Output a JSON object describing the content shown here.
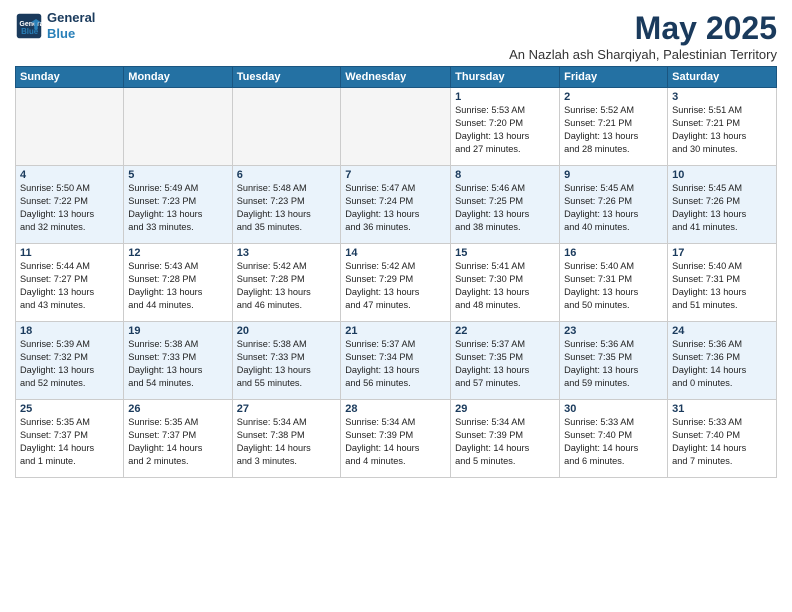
{
  "header": {
    "logo_line1": "General",
    "logo_line2": "Blue",
    "month_title": "May 2025",
    "subtitle": "An Nazlah ash Sharqiyah, Palestinian Territory"
  },
  "weekdays": [
    "Sunday",
    "Monday",
    "Tuesday",
    "Wednesday",
    "Thursday",
    "Friday",
    "Saturday"
  ],
  "weeks": [
    [
      {
        "day": "",
        "detail": ""
      },
      {
        "day": "",
        "detail": ""
      },
      {
        "day": "",
        "detail": ""
      },
      {
        "day": "",
        "detail": ""
      },
      {
        "day": "1",
        "detail": "Sunrise: 5:53 AM\nSunset: 7:20 PM\nDaylight: 13 hours\nand 27 minutes."
      },
      {
        "day": "2",
        "detail": "Sunrise: 5:52 AM\nSunset: 7:21 PM\nDaylight: 13 hours\nand 28 minutes."
      },
      {
        "day": "3",
        "detail": "Sunrise: 5:51 AM\nSunset: 7:21 PM\nDaylight: 13 hours\nand 30 minutes."
      }
    ],
    [
      {
        "day": "4",
        "detail": "Sunrise: 5:50 AM\nSunset: 7:22 PM\nDaylight: 13 hours\nand 32 minutes."
      },
      {
        "day": "5",
        "detail": "Sunrise: 5:49 AM\nSunset: 7:23 PM\nDaylight: 13 hours\nand 33 minutes."
      },
      {
        "day": "6",
        "detail": "Sunrise: 5:48 AM\nSunset: 7:23 PM\nDaylight: 13 hours\nand 35 minutes."
      },
      {
        "day": "7",
        "detail": "Sunrise: 5:47 AM\nSunset: 7:24 PM\nDaylight: 13 hours\nand 36 minutes."
      },
      {
        "day": "8",
        "detail": "Sunrise: 5:46 AM\nSunset: 7:25 PM\nDaylight: 13 hours\nand 38 minutes."
      },
      {
        "day": "9",
        "detail": "Sunrise: 5:45 AM\nSunset: 7:26 PM\nDaylight: 13 hours\nand 40 minutes."
      },
      {
        "day": "10",
        "detail": "Sunrise: 5:45 AM\nSunset: 7:26 PM\nDaylight: 13 hours\nand 41 minutes."
      }
    ],
    [
      {
        "day": "11",
        "detail": "Sunrise: 5:44 AM\nSunset: 7:27 PM\nDaylight: 13 hours\nand 43 minutes."
      },
      {
        "day": "12",
        "detail": "Sunrise: 5:43 AM\nSunset: 7:28 PM\nDaylight: 13 hours\nand 44 minutes."
      },
      {
        "day": "13",
        "detail": "Sunrise: 5:42 AM\nSunset: 7:28 PM\nDaylight: 13 hours\nand 46 minutes."
      },
      {
        "day": "14",
        "detail": "Sunrise: 5:42 AM\nSunset: 7:29 PM\nDaylight: 13 hours\nand 47 minutes."
      },
      {
        "day": "15",
        "detail": "Sunrise: 5:41 AM\nSunset: 7:30 PM\nDaylight: 13 hours\nand 48 minutes."
      },
      {
        "day": "16",
        "detail": "Sunrise: 5:40 AM\nSunset: 7:31 PM\nDaylight: 13 hours\nand 50 minutes."
      },
      {
        "day": "17",
        "detail": "Sunrise: 5:40 AM\nSunset: 7:31 PM\nDaylight: 13 hours\nand 51 minutes."
      }
    ],
    [
      {
        "day": "18",
        "detail": "Sunrise: 5:39 AM\nSunset: 7:32 PM\nDaylight: 13 hours\nand 52 minutes."
      },
      {
        "day": "19",
        "detail": "Sunrise: 5:38 AM\nSunset: 7:33 PM\nDaylight: 13 hours\nand 54 minutes."
      },
      {
        "day": "20",
        "detail": "Sunrise: 5:38 AM\nSunset: 7:33 PM\nDaylight: 13 hours\nand 55 minutes."
      },
      {
        "day": "21",
        "detail": "Sunrise: 5:37 AM\nSunset: 7:34 PM\nDaylight: 13 hours\nand 56 minutes."
      },
      {
        "day": "22",
        "detail": "Sunrise: 5:37 AM\nSunset: 7:35 PM\nDaylight: 13 hours\nand 57 minutes."
      },
      {
        "day": "23",
        "detail": "Sunrise: 5:36 AM\nSunset: 7:35 PM\nDaylight: 13 hours\nand 59 minutes."
      },
      {
        "day": "24",
        "detail": "Sunrise: 5:36 AM\nSunset: 7:36 PM\nDaylight: 14 hours\nand 0 minutes."
      }
    ],
    [
      {
        "day": "25",
        "detail": "Sunrise: 5:35 AM\nSunset: 7:37 PM\nDaylight: 14 hours\nand 1 minute."
      },
      {
        "day": "26",
        "detail": "Sunrise: 5:35 AM\nSunset: 7:37 PM\nDaylight: 14 hours\nand 2 minutes."
      },
      {
        "day": "27",
        "detail": "Sunrise: 5:34 AM\nSunset: 7:38 PM\nDaylight: 14 hours\nand 3 minutes."
      },
      {
        "day": "28",
        "detail": "Sunrise: 5:34 AM\nSunset: 7:39 PM\nDaylight: 14 hours\nand 4 minutes."
      },
      {
        "day": "29",
        "detail": "Sunrise: 5:34 AM\nSunset: 7:39 PM\nDaylight: 14 hours\nand 5 minutes."
      },
      {
        "day": "30",
        "detail": "Sunrise: 5:33 AM\nSunset: 7:40 PM\nDaylight: 14 hours\nand 6 minutes."
      },
      {
        "day": "31",
        "detail": "Sunrise: 5:33 AM\nSunset: 7:40 PM\nDaylight: 14 hours\nand 7 minutes."
      }
    ]
  ]
}
